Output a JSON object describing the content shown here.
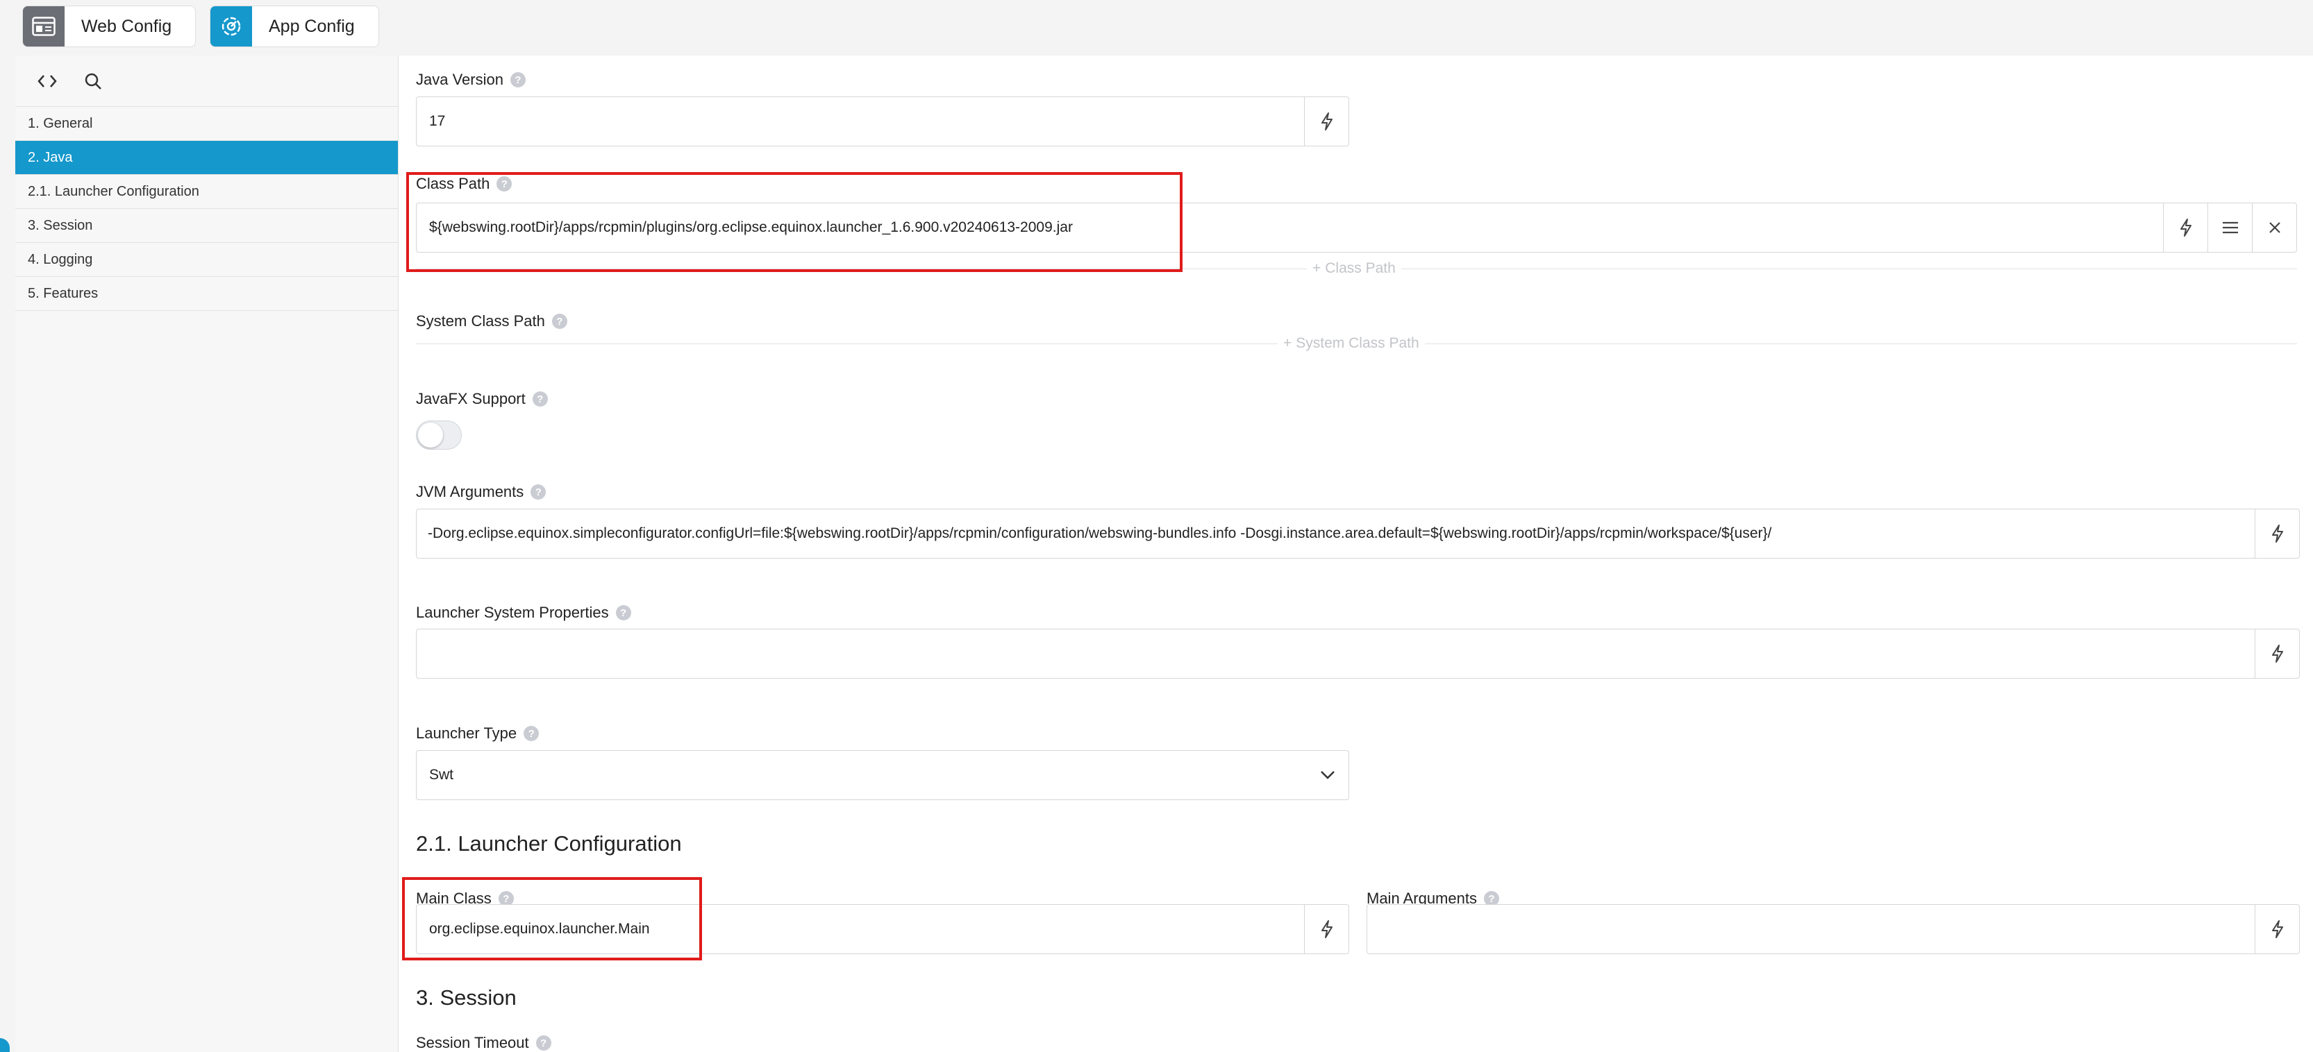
{
  "tabs": [
    {
      "label": "Web Config",
      "icon": "browser-window-icon"
    },
    {
      "label": "App Config",
      "icon": "app-gear-icon"
    }
  ],
  "sidebar": {
    "tools": [
      "code-brackets-icon",
      "search-icon"
    ],
    "items": [
      {
        "label": "1. General",
        "active": false
      },
      {
        "label": "2. Java",
        "active": true
      },
      {
        "label": "2.1. Launcher Configuration",
        "active": false
      },
      {
        "label": "3. Session",
        "active": false
      },
      {
        "label": "4. Logging",
        "active": false
      },
      {
        "label": "5. Features",
        "active": false
      }
    ]
  },
  "form": {
    "java_version": {
      "label": "Java Version",
      "value": "17"
    },
    "class_path": {
      "label": "Class Path",
      "value": "${webswing.rootDir}/apps/rcpmin/plugins/org.eclipse.equinox.launcher_1.6.900.v20240613-2009.jar",
      "add_label": "Class Path"
    },
    "system_class_path": {
      "label": "System Class Path",
      "add_label": "System Class Path"
    },
    "javafx_support": {
      "label": "JavaFX Support",
      "enabled": false
    },
    "jvm_arguments": {
      "label": "JVM Arguments",
      "value": "-Dorg.eclipse.equinox.simpleconfigurator.configUrl=file:${webswing.rootDir}/apps/rcpmin/configuration/webswing-bundles.info -Dosgi.instance.area.default=${webswing.rootDir}/apps/rcpmin/workspace/${user}/"
    },
    "launcher_system_properties": {
      "label": "Launcher System Properties",
      "value": ""
    },
    "launcher_type": {
      "label": "Launcher Type",
      "value": "Swt"
    }
  },
  "launcher_section": {
    "title": "2.1. Launcher Configuration",
    "main_class": {
      "label": "Main Class",
      "value": "org.eclipse.equinox.launcher.Main"
    },
    "main_arguments": {
      "label": "Main Arguments",
      "value": ""
    }
  },
  "session_section": {
    "title": "3. Session",
    "session_timeout_label": "Session Timeout"
  },
  "help_glyph": "?",
  "colors": {
    "accent": "#1598cc",
    "highlight": "#e01b1b",
    "sidebar_bg": "#f7f7f8",
    "web_tab_icon_bg": "#6b6e75"
  }
}
